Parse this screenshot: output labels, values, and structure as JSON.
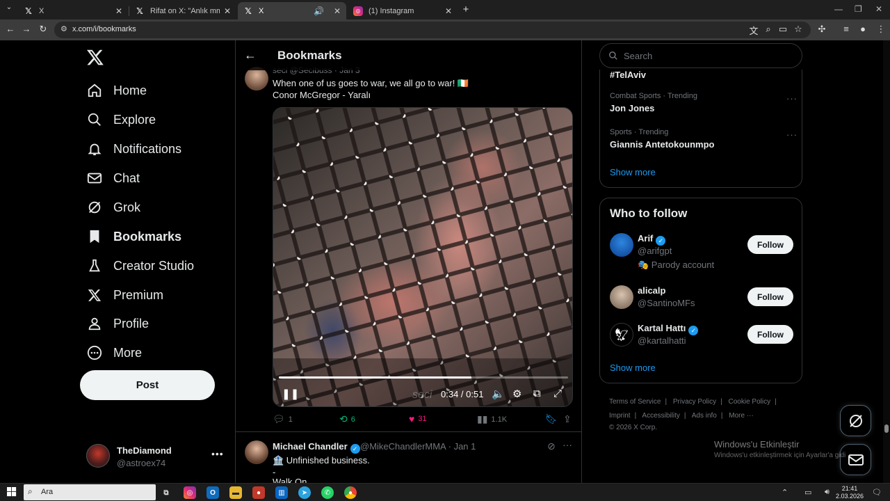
{
  "browser": {
    "tabs": [
      {
        "title": "X",
        "favicon": "x-icon",
        "active": false
      },
      {
        "title": "Rifat on X: \"Anlık mma taymı hi",
        "favicon": "x-icon",
        "active": false
      },
      {
        "title": "X",
        "favicon": "x-icon",
        "active": true
      },
      {
        "title": "(1) Instagram",
        "favicon": "instagram-icon",
        "active": false
      }
    ],
    "url": "x.com/i/bookmarks"
  },
  "sidebar": {
    "items": [
      {
        "label": "Home",
        "icon": "home-icon"
      },
      {
        "label": "Explore",
        "icon": "search-icon"
      },
      {
        "label": "Notifications",
        "icon": "bell-icon"
      },
      {
        "label": "Chat",
        "icon": "mail-icon"
      },
      {
        "label": "Grok",
        "icon": "grok-icon"
      },
      {
        "label": "Bookmarks",
        "icon": "bookmark-icon"
      },
      {
        "label": "Creator Studio",
        "icon": "creator-studio-icon"
      },
      {
        "label": "Premium",
        "icon": "x-icon"
      },
      {
        "label": "Profile",
        "icon": "person-icon"
      },
      {
        "label": "More",
        "icon": "more-circle-icon"
      }
    ],
    "post_label": "Post",
    "account": {
      "name": "TheDiamond",
      "handle": "@astroex74"
    }
  },
  "main": {
    "title": "Bookmarks",
    "tweet1": {
      "headline": "seci @Secibuss · Jan 3",
      "text_line1": "When one of us goes to war, we all go to war! 🇮🇪",
      "text_line2": "Conor McGregor - Yaralı",
      "video": {
        "time": "0:34 / 0:51",
        "watermark": "seci",
        "progress": 0.667
      },
      "replies": "1",
      "reposts": "6",
      "likes": "31",
      "views": "1.1K"
    },
    "tweet2": {
      "name": "Michael Chandler",
      "meta": "@MikeChandlerMMA · Jan 1",
      "text_line1": "🏦 Unfinished business.",
      "text_line2": "-",
      "text_line3": "Walk On"
    }
  },
  "right": {
    "search_placeholder": "Search",
    "trends": [
      {
        "meta": "",
        "title": "#TelAviv"
      },
      {
        "meta": "Combat Sports · Trending",
        "title": "Jon Jones"
      },
      {
        "meta": "Sports · Trending",
        "title": "Giannis Antetokounmpo"
      }
    ],
    "trends_show_more": "Show more",
    "who_to_follow": {
      "title": "Who to follow",
      "accounts": [
        {
          "name": "Arif",
          "handle": "@arifgpt",
          "extra": "🎭 Parody account",
          "verified": true,
          "follow": "Follow"
        },
        {
          "name": "alicalp",
          "handle": "@SantinoMFs",
          "extra": "",
          "verified": false,
          "follow": "Follow"
        },
        {
          "name": "Kartal Hattı",
          "handle": "@kartalhatti",
          "extra": "",
          "verified": true,
          "follow": "Follow"
        }
      ],
      "show_more": "Show more"
    },
    "footer": {
      "links": [
        "Terms of Service",
        "|",
        "Privacy Policy",
        "|",
        "Cookie Policy",
        "|",
        "Imprint",
        "|",
        "Accessibility",
        "|",
        "Ads info",
        "|",
        "More ···"
      ],
      "copyright": "© 2026 X Corp."
    }
  },
  "windows": {
    "activation_title": "Windows'u Etkinleştir",
    "activation_sub": "Windows'u etkinleştirmek için Ayarlar'a gidi",
    "search_text": "Ara",
    "time": "21:41",
    "date": "2.03.2026"
  },
  "colors": {
    "accent": "#1d9bf0",
    "like": "#f91880",
    "repost": "#00ba7c",
    "background": "#000000"
  }
}
